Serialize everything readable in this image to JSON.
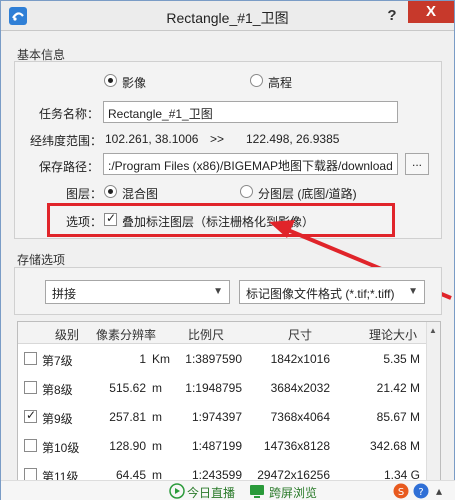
{
  "window": {
    "title": "Rectangle_#1_卫图",
    "help_label": "?",
    "close_label": "X"
  },
  "basic_info": {
    "section_title": "基本信息",
    "type_options": [
      {
        "label": "影像",
        "selected": true
      },
      {
        "label": "高程",
        "selected": false
      }
    ],
    "task_name_label": "任务名称：",
    "task_name_value": "Rectangle_#1_卫图",
    "range_label": "经纬度范围：",
    "range_from": "102.261, 38.1006",
    "range_arrow": ">>",
    "range_to": "122.498, 26.9385",
    "save_path_label": "保存路径：",
    "save_path_value": ":/Program Files (x86)/BIGEMAP地图下载器/download",
    "browse_label": "...",
    "layer_label": "图层：",
    "layer_options": [
      {
        "label": "混合图",
        "selected": true
      },
      {
        "label": "分图层 (底图/道路)",
        "selected": false
      }
    ],
    "option_label": "选项：",
    "overlay_label": "叠加标注图层（标注栅格化到影像）",
    "overlay_checked": true
  },
  "storage": {
    "section_title": "存储选项",
    "mode_value": "拼接",
    "format_value": "标记图像文件格式 (*.tif;*.tiff)"
  },
  "table": {
    "headers": [
      "级别",
      "像素分辨率",
      "比例尺",
      "尺寸",
      "理论大小"
    ],
    "rows": [
      {
        "checked": false,
        "level": "第7级",
        "res_value": "1",
        "res_unit": "Km",
        "scale": "1:3897590",
        "size": "1842x1016",
        "est": "5.35 M"
      },
      {
        "checked": false,
        "level": "第8级",
        "res_value": "515.62",
        "res_unit": "m",
        "scale": "1:1948795",
        "size": "3684x2032",
        "est": "21.42 M"
      },
      {
        "checked": true,
        "level": "第9级",
        "res_value": "257.81",
        "res_unit": "m",
        "scale": "1:974397",
        "size": "7368x4064",
        "est": "85.67 M"
      },
      {
        "checked": false,
        "level": "第10级",
        "res_value": "128.90",
        "res_unit": "m",
        "scale": "1:487199",
        "size": "14736x8128",
        "est": "342.68 M"
      },
      {
        "checked": false,
        "level": "第11级",
        "res_value": "64.45",
        "res_unit": "m",
        "scale": "1:243599",
        "size": "29472x16256",
        "est": "1.34 G"
      }
    ]
  },
  "bottom_bar": {
    "live_label": "今日直播",
    "browse_label": "跨屏浏览"
  },
  "colors": {
    "highlight": "#e0242a",
    "close": "#c7392b",
    "title_bg": "#ececec"
  }
}
